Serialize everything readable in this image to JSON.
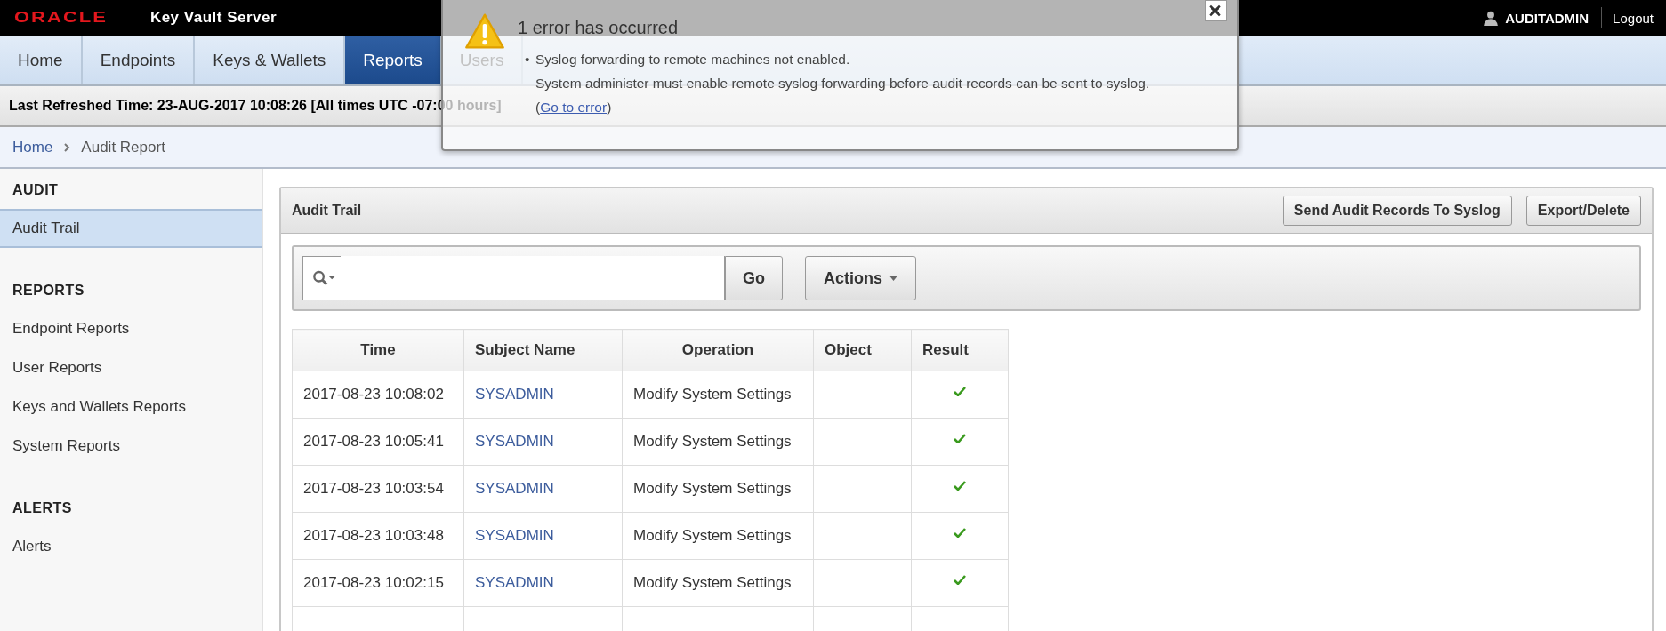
{
  "header": {
    "logo": "ORACLE",
    "product": "Key Vault Server",
    "user": "AUDITADMIN",
    "logout": "Logout"
  },
  "tabs": [
    {
      "label": "Home",
      "selected": false
    },
    {
      "label": "Endpoints",
      "selected": false
    },
    {
      "label": "Keys & Wallets",
      "selected": false
    },
    {
      "label": "Reports",
      "selected": true
    },
    {
      "label": "Users",
      "selected": false
    }
  ],
  "refresh_bar": "Last Refreshed Time: 23-AUG-2017 10:08:26 [All times UTC -07:00 hours]",
  "breadcrumb": [
    "Home",
    "Audit Report"
  ],
  "sidebar": [
    {
      "heading": "AUDIT",
      "items": [
        {
          "label": "Audit Trail",
          "selected": true
        }
      ]
    },
    {
      "heading": "REPORTS",
      "items": [
        {
          "label": "Endpoint Reports",
          "selected": false
        },
        {
          "label": "User Reports",
          "selected": false
        },
        {
          "label": "Keys and Wallets Reports",
          "selected": false
        },
        {
          "label": "System Reports",
          "selected": false
        }
      ]
    },
    {
      "heading": "ALERTS",
      "items": [
        {
          "label": "Alerts",
          "selected": false
        }
      ]
    }
  ],
  "panel": {
    "title": "Audit Trail",
    "buttons": [
      "Send Audit Records To Syslog",
      "Export/Delete"
    ],
    "go": "Go",
    "actions": "Actions"
  },
  "table": {
    "columns": [
      "Time",
      "Subject Name",
      "Operation",
      "Object",
      "Result"
    ],
    "rows": [
      {
        "time": "2017-08-23 10:08:02",
        "subject": "SYSADMIN",
        "operation": "Modify System Settings",
        "succeeded": true
      },
      {
        "time": "2017-08-23 10:05:41",
        "subject": "SYSADMIN",
        "operation": "Modify System Settings",
        "succeeded": true
      },
      {
        "time": "2017-08-23 10:03:54",
        "subject": "SYSADMIN",
        "operation": "Modify System Settings",
        "succeeded": true
      },
      {
        "time": "2017-08-23 10:03:48",
        "subject": "SYSADMIN",
        "operation": "Modify System Settings",
        "succeeded": true
      },
      {
        "time": "2017-08-23 10:02:15",
        "subject": "SYSADMIN",
        "operation": "Modify System Settings",
        "succeeded": true
      }
    ]
  },
  "error_dialog": {
    "title": "1 error has occurred",
    "bullet": "•",
    "message": "Syslog forwarding to remote machines not enabled.",
    "detail": "System administer must enable remote syslog forwarding before audit records can be sent to syslog.",
    "link_open": "(",
    "link": "Go to error",
    "link_close": ")"
  }
}
